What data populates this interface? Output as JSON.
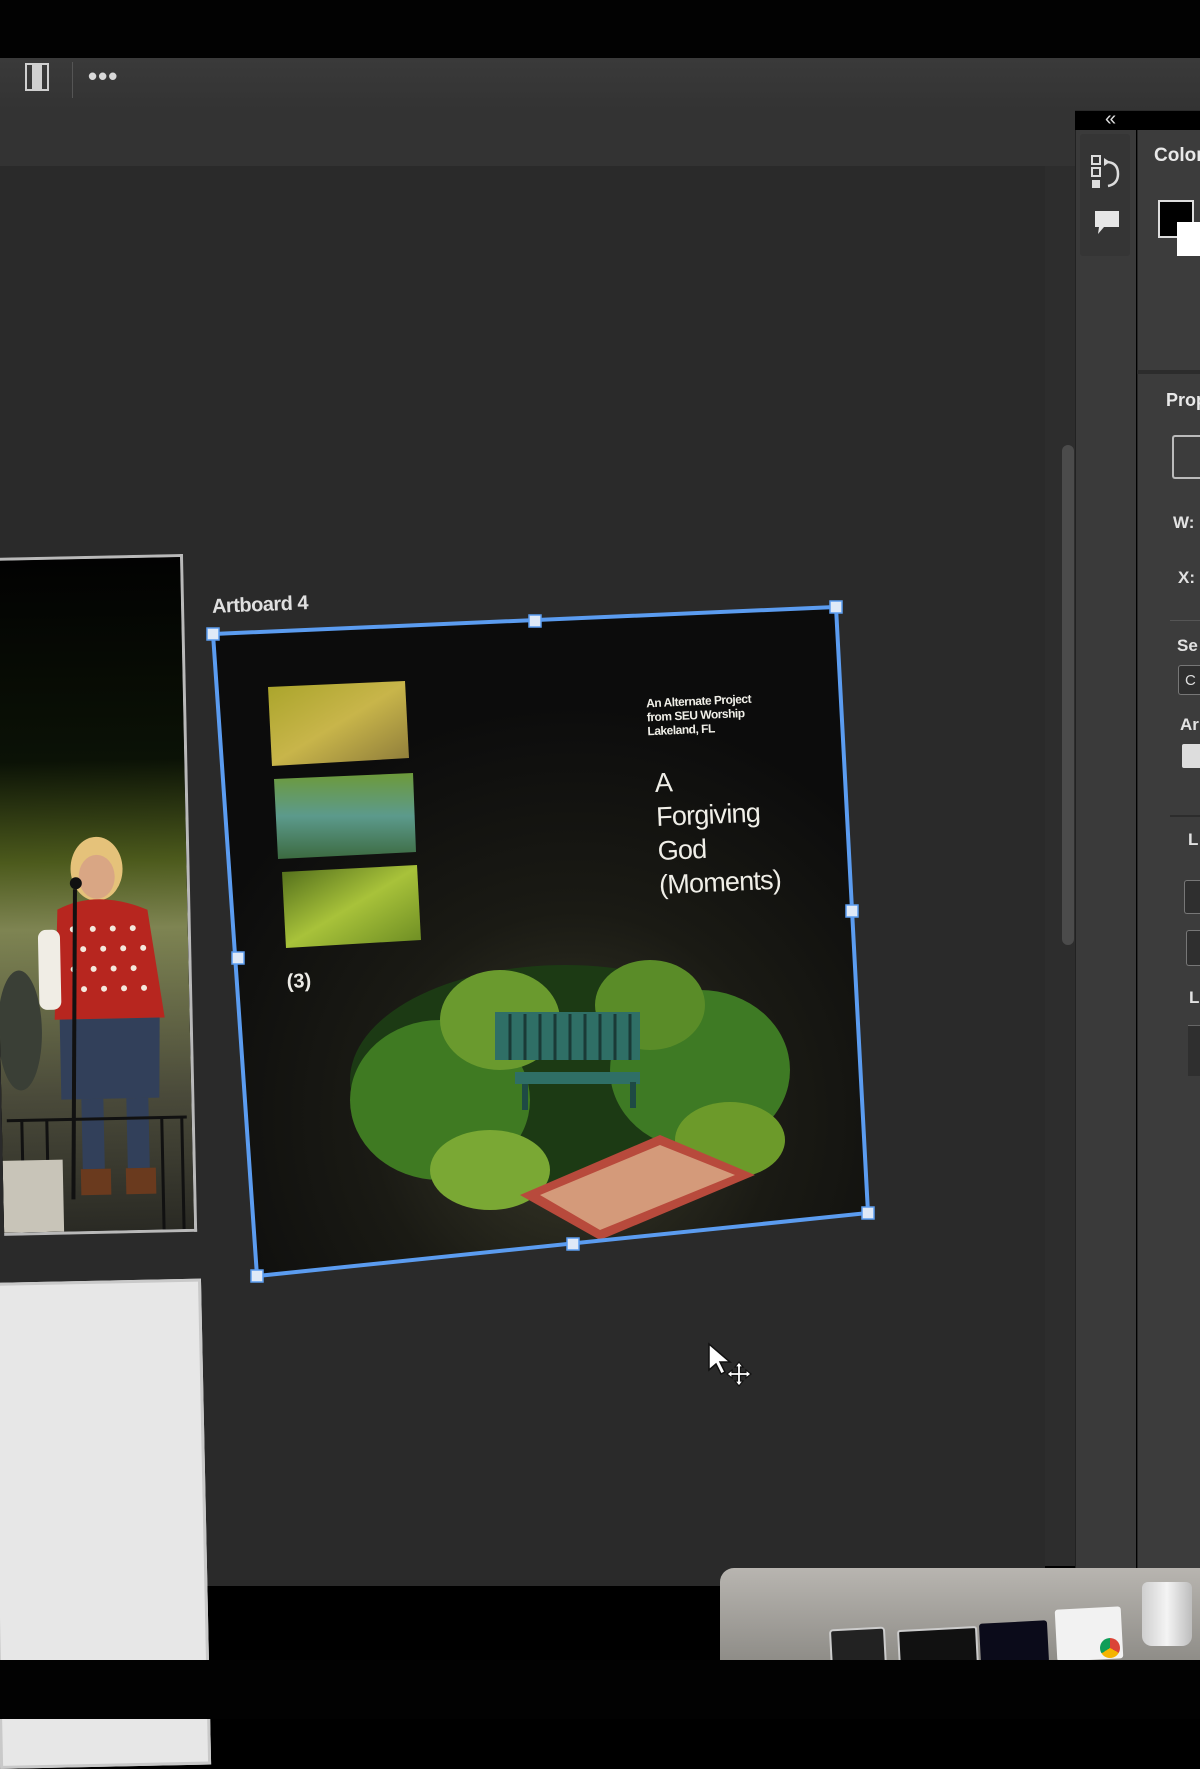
{
  "toolbar": {
    "more_icon": "•••",
    "panel_icon": "panel-toggle-icon"
  },
  "right_panel": {
    "collapse_icon": "«",
    "color_title": "Color",
    "properties_title": "Prop",
    "w_label": "W:",
    "x_label": "X:",
    "set_label": "Se",
    "set_field_value": "C",
    "ar_label": "Ar",
    "layer_label_1": "L",
    "layer_label_2": "L"
  },
  "artboard": {
    "label": "Artboard 4",
    "cover": {
      "credit_line_1": "An Alternate Project",
      "credit_line_2": "from SEU Worship",
      "credit_line_3": "Lakeland, FL",
      "title_line_1": "A",
      "title_line_2": "Forgiving",
      "title_line_3": "God",
      "title_line_4": "(Moments)",
      "number": "(3)"
    }
  },
  "colors": {
    "selection": "#5b9cf0",
    "canvas": "#2a2a2a",
    "panel": "#3c3c3c",
    "foreground_swatch": "#000000",
    "background_swatch": "#ffffff"
  }
}
